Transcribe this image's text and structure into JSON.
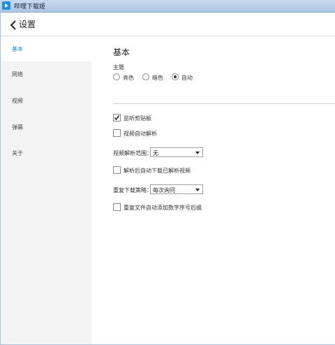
{
  "window": {
    "title": "哔哩下载姬"
  },
  "header": {
    "title": "设置"
  },
  "sidebar": {
    "items": [
      {
        "label": "基本",
        "active": true
      },
      {
        "label": "网络"
      },
      {
        "label": "视频"
      },
      {
        "label": "弹幕"
      },
      {
        "label": "关于"
      }
    ]
  },
  "main": {
    "section_title": "基本",
    "theme": {
      "label": "主题",
      "options": [
        "亮色",
        "暗色",
        "自动"
      ],
      "selected": "自动"
    },
    "options": {
      "monitor_clipboard": {
        "label": "监听剪贴板",
        "checked": true
      },
      "auto_parse_video": {
        "label": "视频自动解析",
        "checked": false
      },
      "parse_scope": {
        "label": "视频解析范围：",
        "value": "无"
      },
      "auto_download_after_parse": {
        "label": "解析后自动下载已解析视频",
        "checked": false
      },
      "duplicate_strategy": {
        "label": "重复下载策略：",
        "value": "每次询问"
      },
      "numeric_suffix": {
        "label": "重复文件自动添加数字序号后缀",
        "checked": false
      }
    }
  },
  "colors": {
    "accent": "#1b8be0",
    "sidebar_bg": "#f3f3f3"
  }
}
